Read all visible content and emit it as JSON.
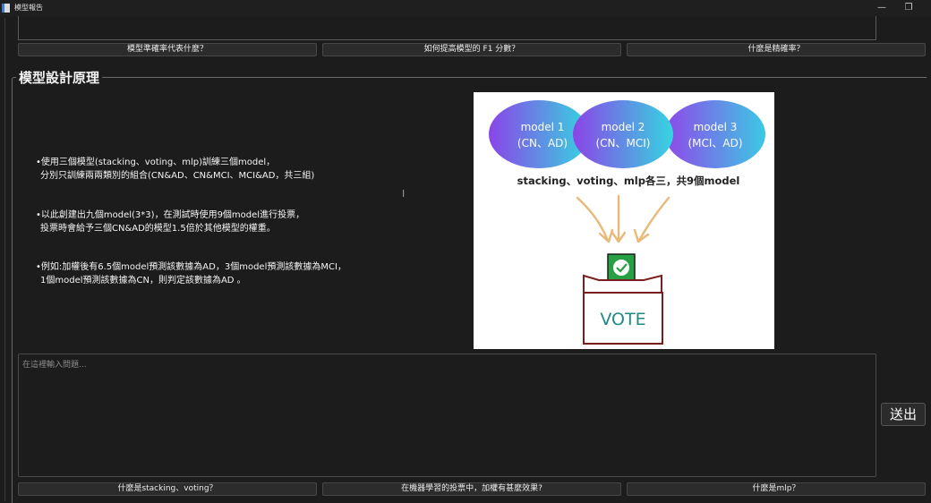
{
  "window": {
    "title": "模型報告",
    "min_symbol": "—",
    "max_symbol": "❐"
  },
  "top_buttons": [
    {
      "label": "模型準確率代表什麼？"
    },
    {
      "label": "如何提高模型的 F1 分數？"
    },
    {
      "label": "什麼是精確率？"
    }
  ],
  "section": {
    "title": "模型設計原理",
    "bullets": [
      {
        "line1": "•使用三個模型(stacking、voting、mlp)訓練三個model，",
        "line2": "分別只訓練兩兩類別的組合(CN&AD、CN&MCI、MCI&AD，共三組)"
      },
      {
        "line1": "•以此創建出九個model(3*3)，在測試時使用9個model進行投票，",
        "line2": "投票時會給予三個CN&AD的模型1.5倍於其他模型的權重。"
      },
      {
        "line1": "•例如:加權後有6.5個model預測該數據為AD，3個model預測該數據為MCI，",
        "line2": "1個model預測該數據為CN，則判定該數據為AD 。"
      }
    ],
    "cursor": "I"
  },
  "diagram": {
    "models": [
      {
        "name": "model 1",
        "classes": "(CN、AD)"
      },
      {
        "name": "model 2",
        "classes": "(CN、MCI)"
      },
      {
        "name": "model 3",
        "classes": "(MCI、AD)"
      }
    ],
    "caption": "stacking、voting、mlp各三，共9個model",
    "vote_label": "VOTE",
    "colors": {
      "ellipse_start": "#8b44e8",
      "ellipse_end": "#35d5e0",
      "arrow": "#e8b978",
      "box": "#7a1f1f",
      "vote_text": "#1f8a86",
      "ballot": "#27a043"
    }
  },
  "input": {
    "placeholder": "在這裡輸入問題...",
    "value": ""
  },
  "send_button": {
    "label": "送出"
  },
  "bottom_buttons": [
    {
      "label": "什麼是stacking、voting？"
    },
    {
      "label": "在機器學習的投票中，加權有甚麼效果?"
    },
    {
      "label": "什麼是mlp？"
    }
  ]
}
